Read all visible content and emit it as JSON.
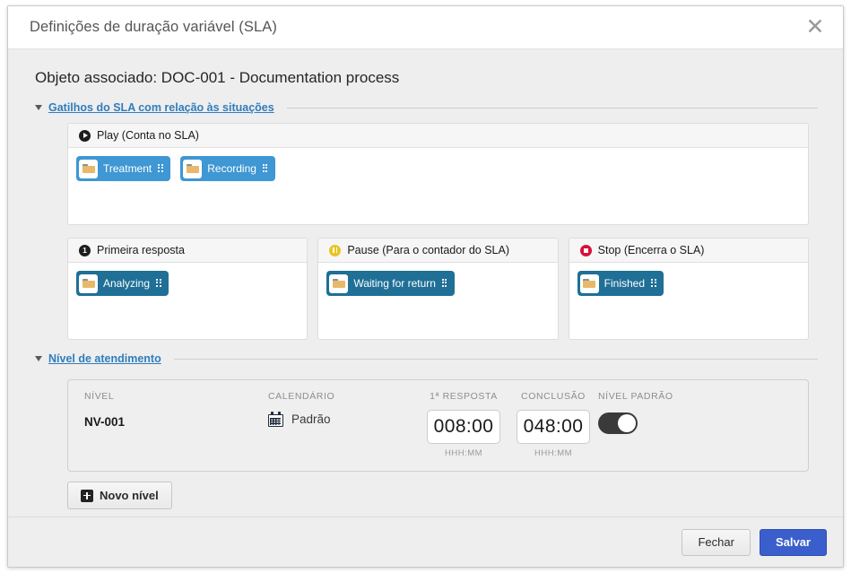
{
  "dialog": {
    "title": "Definições de duração variável (SLA)",
    "close_icon": "close-icon",
    "associated_object": "Objeto associado: DOC-001 - Documentation process"
  },
  "sections": {
    "triggers": {
      "title": "Gatilhos do SLA com relação às situações",
      "caret": "caret-down-icon"
    },
    "service_level": {
      "title": "Nível de atendimento",
      "caret": "caret-down-icon"
    }
  },
  "panels": [
    {
      "id": "play",
      "icon": "play-circle-icon",
      "label": "Play (Conta no SLA)",
      "tag_style": "tag-play",
      "tags": [
        {
          "label": "Treatment",
          "icon": "folder-icon",
          "grip": "drag-handle-icon"
        },
        {
          "label": "Recording",
          "icon": "folder-icon",
          "grip": "drag-handle-icon"
        }
      ]
    },
    {
      "id": "first-response",
      "icon": "number-one-circle-icon",
      "label": "Primeira resposta",
      "tag_style": "tag-dark",
      "tags": [
        {
          "label": "Analyzing",
          "icon": "folder-icon",
          "grip": "drag-handle-icon"
        }
      ]
    },
    {
      "id": "pause",
      "icon": "pause-circle-icon",
      "label": "Pause (Para o contador do SLA)",
      "tag_style": "tag-dark",
      "tags": [
        {
          "label": "Waiting for return",
          "icon": "folder-icon",
          "grip": "drag-handle-icon"
        }
      ]
    },
    {
      "id": "stop",
      "icon": "stop-circle-icon",
      "label": "Stop (Encerra o SLA)",
      "tag_style": "tag-dark",
      "tags": [
        {
          "label": "Finished",
          "icon": "folder-icon",
          "grip": "drag-handle-icon"
        }
      ]
    }
  ],
  "service_level_table": {
    "headers": {
      "nivel": "NÍVEL",
      "calendario": "CALENDÁRIO",
      "primeira_resposta": "1ª RESPOSTA",
      "conclusao": "CONCLUSÃO",
      "nivel_padrao": "NÍVEL PADRÃO"
    },
    "row": {
      "nivel": "NV-001",
      "calendario_icon": "calendar-icon",
      "calendario": "Padrão",
      "primeira_resposta_value": "008:00",
      "primeira_resposta_hint": "HHH:MM",
      "conclusao_value": "048:00",
      "conclusao_hint": "HHH:MM",
      "nivel_padrao_on": true
    }
  },
  "buttons": {
    "new_level": "Novo nível",
    "new_level_icon": "plus-square-icon",
    "close": "Fechar",
    "save": "Salvar"
  },
  "colors": {
    "accent_link": "#2f7dbd",
    "tag_play": "#3f97d3",
    "tag_dark": "#1f6f96",
    "save_button": "#3a5fcd",
    "pause_icon": "#e8c427",
    "stop_icon": "#d8103c",
    "folder": "#e8b96a"
  }
}
